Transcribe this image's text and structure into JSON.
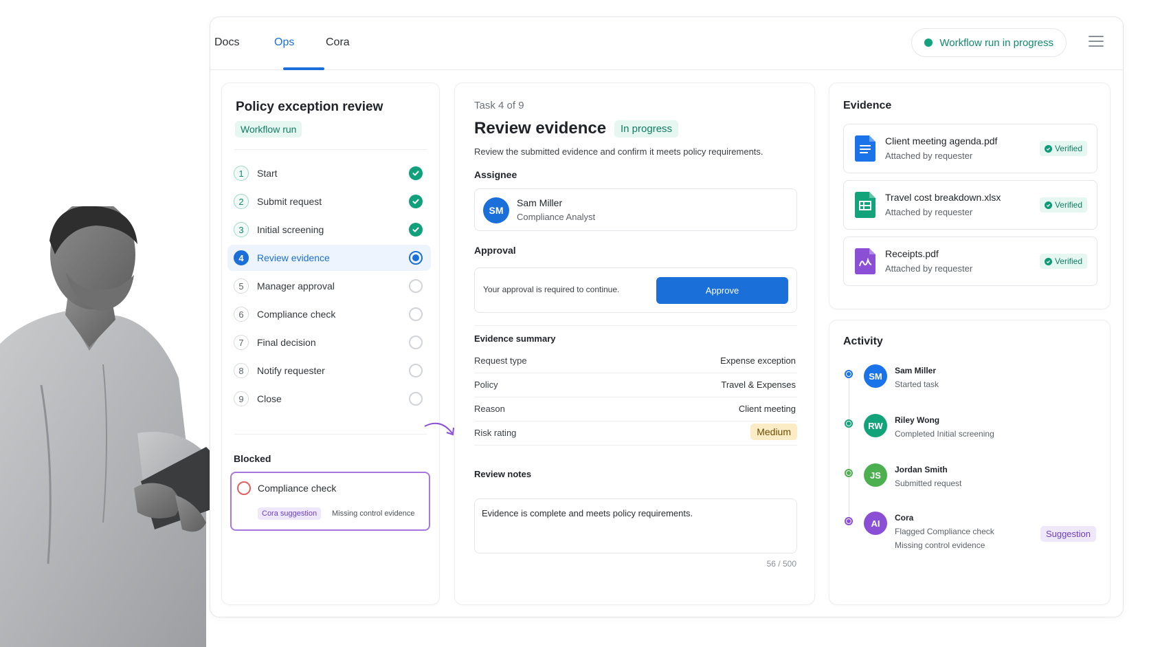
{
  "tabs": [
    {
      "label": "Docs"
    },
    {
      "label": "Ops"
    },
    {
      "label": "Cora"
    }
  ],
  "active_tab": "Ops",
  "status": {
    "label": "Workflow run in progress",
    "color": "#14a37f"
  },
  "workflow": {
    "title": "Policy exception review",
    "badge": "Workflow run",
    "steps": [
      {
        "num": "1",
        "label": "Start",
        "state": "done"
      },
      {
        "num": "2",
        "label": "Submit request",
        "state": "done"
      },
      {
        "num": "3",
        "label": "Initial screening",
        "state": "done"
      },
      {
        "num": "4",
        "label": "Review evidence",
        "state": "current"
      },
      {
        "num": "5",
        "label": "Manager approval",
        "state": "pending"
      },
      {
        "num": "6",
        "label": "Compliance check",
        "state": "pending"
      },
      {
        "num": "7",
        "label": "Final decision",
        "state": "pending"
      },
      {
        "num": "8",
        "label": "Notify requester",
        "state": "pending"
      },
      {
        "num": "9",
        "label": "Close",
        "state": "pending"
      }
    ],
    "blocked": {
      "title": "Blocked",
      "item": "Compliance check",
      "tag": "Cora suggestion",
      "reason": "Missing control evidence"
    }
  },
  "task": {
    "counter": "Task 4 of 9",
    "title": "Review evidence",
    "status_badge": "In progress",
    "description": "Review the submitted evidence and confirm it meets policy requirements.",
    "assignee_label": "Assignee",
    "assignee": {
      "initials": "SM",
      "name": "Sam Miller",
      "role": "Compliance Analyst"
    },
    "approval_label": "Approval",
    "approval_text": "Your approval is required to continue.",
    "approve_button": "Approve",
    "summary_label": "Evidence summary",
    "summary": [
      {
        "key": "Request type",
        "value": "Expense exception"
      },
      {
        "key": "Policy",
        "value": "Travel & Expenses"
      },
      {
        "key": "Reason",
        "value": "Client meeting"
      },
      {
        "key": "Risk rating",
        "value": "Medium"
      }
    ],
    "notes_label": "Review notes",
    "notes_value": "Evidence is complete and meets policy requirements.",
    "notes_count": "56 / 500"
  },
  "evidence": {
    "title": "Evidence",
    "files": [
      {
        "name": "Client meeting agenda.pdf",
        "sub": "Attached by requester",
        "status": "Verified",
        "icon": "doc-icon",
        "color": "#1a73e8"
      },
      {
        "name": "Travel cost breakdown.xlsx",
        "sub": "Attached by requester",
        "status": "Verified",
        "icon": "sheet-icon",
        "color": "#12a37a"
      },
      {
        "name": "Receipts.pdf",
        "sub": "Attached by requester",
        "status": "Verified",
        "icon": "image-file-icon",
        "color": "#8b4fd6"
      }
    ]
  },
  "activity": {
    "title": "Activity",
    "items": [
      {
        "initials": "SM",
        "name": "Sam Miller",
        "line1": "Started task",
        "line2": "",
        "color": "#1a73e8"
      },
      {
        "initials": "RW",
        "name": "Riley Wong",
        "line1": "Completed Initial screening",
        "line2": "",
        "color": "#12a37a"
      },
      {
        "initials": "JS",
        "name": "Jordan Smith",
        "line1": "Submitted request",
        "line2": "",
        "color": "#4caf50"
      },
      {
        "initials": "AI",
        "name": "Cora",
        "line1": "Flagged Compliance check",
        "line2": "Missing control evidence",
        "color": "#8b4fd6"
      }
    ],
    "suggestion_badge": "Suggestion"
  }
}
